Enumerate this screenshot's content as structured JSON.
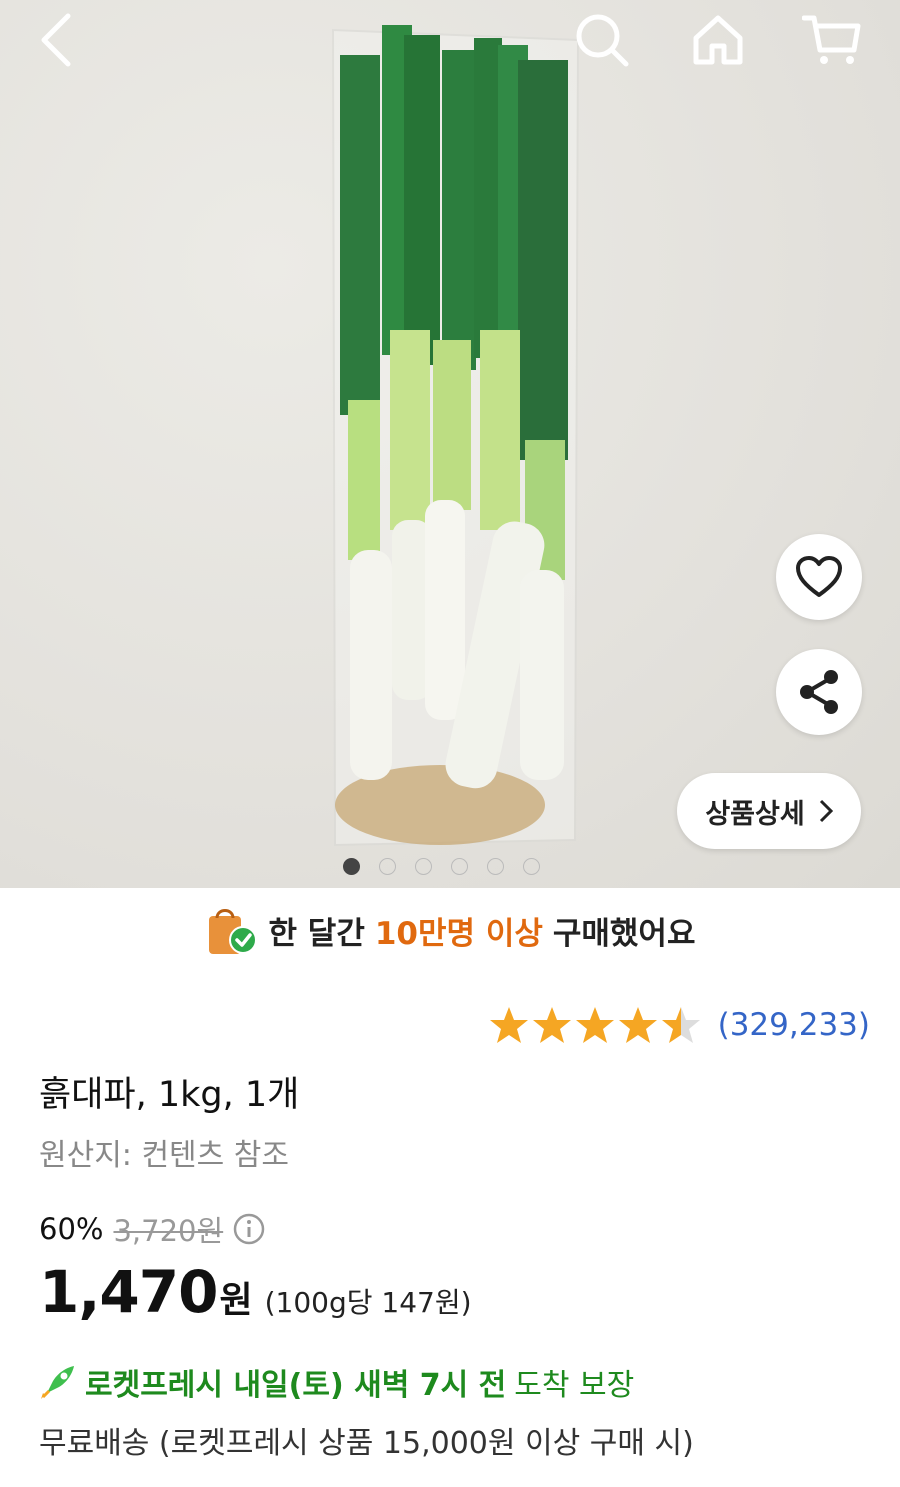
{
  "topbar": {
    "icons": [
      "back-icon",
      "search-icon",
      "home-icon",
      "cart-icon"
    ]
  },
  "hero": {
    "image_alt": "흙대파",
    "page_dots": 6,
    "active_dot": 1,
    "detail_button_label": "상품상세",
    "floating_icons": [
      "heart-icon",
      "share-icon"
    ]
  },
  "banner": {
    "prefix": "한 달간",
    "highlight": "10만명 이상",
    "suffix": "구매했어요",
    "highlight_color": "#e0690f"
  },
  "rating": {
    "stars": 4.5,
    "max_stars": 5,
    "count": "(329,233)"
  },
  "product": {
    "title": "흙대파, 1kg, 1개",
    "origin": "원산지: 컨텐츠 참조"
  },
  "pricing": {
    "discount": "60%",
    "original_price": "3,720원",
    "price": "1,470",
    "currency": "원",
    "unit_price": "(100g당 147원)"
  },
  "delivery": {
    "bold_text": "로켓프레시 내일(토) 새벽 7시 전",
    "normal_text": "도착 보장",
    "shipping": "무료배송 (로켓프레시 상품 15,000원 이상 구매 시)",
    "accent_color": "#1e8a1e"
  }
}
